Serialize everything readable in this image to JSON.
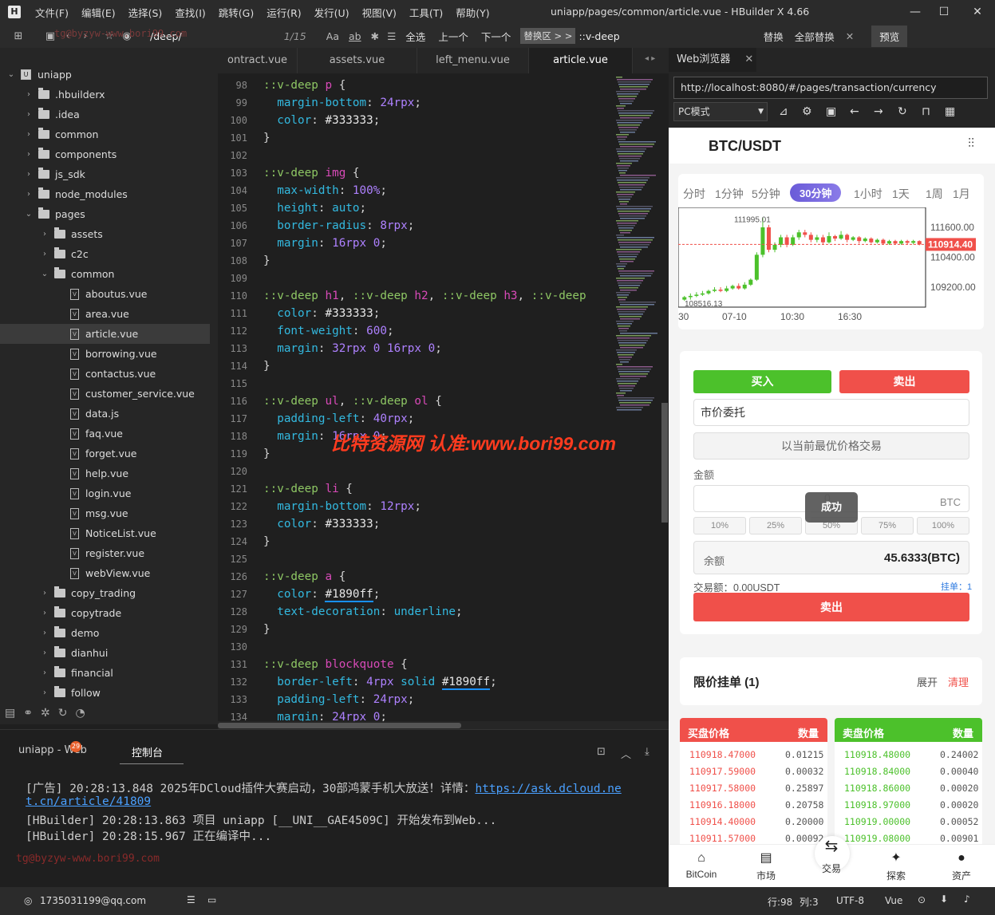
{
  "window": {
    "title": "uniapp/pages/common/article.vue - HBuilder X 4.66",
    "menu": [
      "文件(F)",
      "编辑(E)",
      "选择(S)",
      "查找(I)",
      "跳转(G)",
      "运行(R)",
      "发行(U)",
      "视图(V)",
      "工具(T)",
      "帮助(Y)"
    ],
    "controls": {
      "min": "—",
      "max": "☐",
      "close": "✕"
    }
  },
  "toolbar": {
    "search_value": "/deep/",
    "match_count": "1/15",
    "case_icon": "Aa",
    "word_icon": "ab",
    "select_all": "全选",
    "prev": "上一个",
    "next": "下一个",
    "replace_zone": "替换区 > >",
    "replace_value": "::v-deep",
    "replace": "替换",
    "replace_all": "全部替换",
    "preview": "预览",
    "watermark_small": "tg@byzyw-www.bori99.com"
  },
  "sidebar": {
    "items": [
      {
        "label": "uniapp",
        "type": "root",
        "open": true,
        "level": 0
      },
      {
        "label": ".hbuilderx",
        "type": "folder",
        "open": false,
        "level": 1
      },
      {
        "label": ".idea",
        "type": "folder",
        "open": false,
        "level": 1
      },
      {
        "label": "common",
        "type": "folder",
        "open": false,
        "level": 1
      },
      {
        "label": "components",
        "type": "folder",
        "open": false,
        "level": 1
      },
      {
        "label": "js_sdk",
        "type": "folder",
        "open": false,
        "level": 1
      },
      {
        "label": "node_modules",
        "type": "folder",
        "open": false,
        "level": 1
      },
      {
        "label": "pages",
        "type": "folder",
        "open": true,
        "level": 1
      },
      {
        "label": "assets",
        "type": "folder",
        "open": false,
        "level": 2
      },
      {
        "label": "c2c",
        "type": "folder",
        "open": false,
        "level": 2
      },
      {
        "label": "common",
        "type": "folder",
        "open": true,
        "level": 2
      },
      {
        "label": "aboutus.vue",
        "type": "file",
        "level": 3
      },
      {
        "label": "area.vue",
        "type": "file",
        "level": 3
      },
      {
        "label": "article.vue",
        "type": "file",
        "level": 3,
        "selected": true
      },
      {
        "label": "borrowing.vue",
        "type": "file",
        "level": 3
      },
      {
        "label": "contactus.vue",
        "type": "file",
        "level": 3
      },
      {
        "label": "customer_service.vue",
        "type": "file",
        "level": 3
      },
      {
        "label": "data.js",
        "type": "file",
        "level": 3
      },
      {
        "label": "faq.vue",
        "type": "file",
        "level": 3
      },
      {
        "label": "forget.vue",
        "type": "file",
        "level": 3
      },
      {
        "label": "help.vue",
        "type": "file",
        "level": 3
      },
      {
        "label": "login.vue",
        "type": "file",
        "level": 3
      },
      {
        "label": "msg.vue",
        "type": "file",
        "level": 3
      },
      {
        "label": "NoticeList.vue",
        "type": "file",
        "level": 3
      },
      {
        "label": "register.vue",
        "type": "file",
        "level": 3
      },
      {
        "label": "webView.vue",
        "type": "file",
        "level": 3
      },
      {
        "label": "copy_trading",
        "type": "folder",
        "open": false,
        "level": 2
      },
      {
        "label": "copytrade",
        "type": "folder",
        "open": false,
        "level": 2
      },
      {
        "label": "demo",
        "type": "folder",
        "open": false,
        "level": 2
      },
      {
        "label": "dianhui",
        "type": "folder",
        "open": false,
        "level": 2
      },
      {
        "label": "financial",
        "type": "folder",
        "open": false,
        "level": 2
      },
      {
        "label": "follow",
        "type": "folder",
        "open": false,
        "level": 2
      }
    ]
  },
  "editor": {
    "tabs": [
      "ontract.vue",
      "assets.vue",
      "left_menu.vue",
      "article.vue"
    ],
    "active_tab": "article.vue",
    "lines": [
      {
        "n": "98",
        "html": "<span class='k'>::v-deep</span> <span class='t'>p</span> {"
      },
      {
        "n": "99",
        "html": "  <span class='p'>margin-bottom</span>: <span class='n'>24rpx</span>;"
      },
      {
        "n": "100",
        "html": "  <span class='p'>color</span>: <span class='h'>#333333</span>;"
      },
      {
        "n": "101",
        "html": "}"
      },
      {
        "n": "102",
        "html": ""
      },
      {
        "n": "103",
        "html": "<span class='k'>::v-deep</span> <span class='t'>img</span> {"
      },
      {
        "n": "104",
        "html": "  <span class='p'>max-width</span>: <span class='n'>100%</span>;"
      },
      {
        "n": "105",
        "html": "  <span class='p'>height</span>: <span class='p'>auto</span>;"
      },
      {
        "n": "106",
        "html": "  <span class='p'>border-radius</span>: <span class='n'>8rpx</span>;"
      },
      {
        "n": "107",
        "html": "  <span class='p'>margin</span>: <span class='n'>16rpx</span> <span class='n'>0</span>;"
      },
      {
        "n": "108",
        "html": "}"
      },
      {
        "n": "109",
        "html": ""
      },
      {
        "n": "110",
        "html": "<span class='k'>::v-deep</span> <span class='t'>h1</span>, <span class='k'>::v-deep</span> <span class='t'>h2</span>, <span class='k'>::v-deep</span> <span class='t'>h3</span>, <span class='k'>::v-deep</span>"
      },
      {
        "n": "111",
        "html": "  <span class='p'>color</span>: <span class='h'>#333333</span>;"
      },
      {
        "n": "112",
        "html": "  <span class='p'>font-weight</span>: <span class='n'>600</span>;"
      },
      {
        "n": "113",
        "html": "  <span class='p'>margin</span>: <span class='n'>32rpx</span> <span class='n'>0</span> <span class='n'>16rpx</span> <span class='n'>0</span>;"
      },
      {
        "n": "114",
        "html": "}"
      },
      {
        "n": "115",
        "html": ""
      },
      {
        "n": "116",
        "html": "<span class='k'>::v-deep</span> <span class='t'>ul</span>, <span class='k'>::v-deep</span> <span class='t'>ol</span> {"
      },
      {
        "n": "117",
        "html": "  <span class='p'>padding-left</span>: <span class='n'>40rpx</span>;"
      },
      {
        "n": "118",
        "html": "  <span class='p'>margin</span>: <span class='n'>16rpx</span> <span class='n'>0</span>;"
      },
      {
        "n": "119",
        "html": "}"
      },
      {
        "n": "120",
        "html": ""
      },
      {
        "n": "121",
        "html": "<span class='k'>::v-deep</span> <span class='t'>li</span> {"
      },
      {
        "n": "122",
        "html": "  <span class='p'>margin-bottom</span>: <span class='n'>12rpx</span>;"
      },
      {
        "n": "123",
        "html": "  <span class='p'>color</span>: <span class='h'>#333333</span>;"
      },
      {
        "n": "124",
        "html": "}"
      },
      {
        "n": "125",
        "html": ""
      },
      {
        "n": "126",
        "html": "<span class='k'>::v-deep</span> <span class='t'>a</span> {"
      },
      {
        "n": "127",
        "html": "  <span class='p'>color</span>: <span class='h' style='border-bottom:2px solid #1890ff'>#1890ff</span>;"
      },
      {
        "n": "128",
        "html": "  <span class='p'>text-decoration</span>: <span class='p'>underline</span>;"
      },
      {
        "n": "129",
        "html": "}"
      },
      {
        "n": "130",
        "html": ""
      },
      {
        "n": "131",
        "html": "<span class='k'>::v-deep</span> <span class='t'>blockquote</span> {"
      },
      {
        "n": "132",
        "html": "  <span class='p'>border-left</span>: <span class='n'>4rpx</span> <span class='p'>solid</span> <span class='h' style='border-bottom:2px solid #1890ff'>#1890ff</span>;"
      },
      {
        "n": "133",
        "html": "  <span class='p'>padding-left</span>: <span class='n'>24rpx</span>;"
      },
      {
        "n": "134",
        "html": "  <span class='p'>margin</span>: <span class='n'>24rpx</span> <span class='n'>0</span>;"
      }
    ],
    "watermark": "比特资源网 认准:www.bori99.com"
  },
  "console": {
    "tabs": [
      "uniapp - Web",
      "控制台"
    ],
    "badge": "29",
    "lines": [
      {
        "text": "[广告] 20:28:13.848 2025年DCloud插件大赛启动，30部鸿蒙手机大放送！详情：",
        "link": "https://ask.dcloud.ne"
      },
      {
        "text": "",
        "link": "t.cn/article/41809"
      },
      {
        "text": "[HBuilder] 20:28:13.863 项目 uniapp [__UNI__GAE4509C] 开始发布到Web...",
        "link": ""
      },
      {
        "text": "[HBuilder] 20:28:15.967 正在编译中...",
        "link": ""
      }
    ],
    "watermark": "tg@byzyw-www.bori99.com"
  },
  "status": {
    "user": "1735031199@qq.com",
    "line": "行:98",
    "col": "列:3",
    "encoding": "UTF-8",
    "lang": "Vue"
  },
  "browser": {
    "tab": "Web浏览器",
    "url": "http://localhost:8080/#/pages/transaction/currency",
    "mode": "PC模式",
    "page": {
      "pair": "BTC/USDT",
      "periods": [
        "分时",
        "1分钟",
        "5分钟",
        "30分钟",
        "1小时",
        "1天",
        "1周",
        "1月"
      ],
      "active_period": "30分钟",
      "price_axis": [
        "111600.00",
        "110400.00",
        "109200.00"
      ],
      "current_price": "110914.40",
      "high_label": "111995.01",
      "low_label": "108516.13",
      "time_axis": [
        "30",
        "07-10",
        "10:30",
        "16:30"
      ],
      "buy": "买入",
      "sell": "卖出",
      "order_type": "市价委托",
      "best_price": "以当前最优价格交易",
      "amount_label": "金额",
      "amount_value": "0",
      "amount_unit": "BTC",
      "toast": "成功",
      "percents": [
        "10%",
        "25%",
        "50%",
        "75%",
        "100%"
      ],
      "balance_label": "余额",
      "balance_value": "45.6333(BTC)",
      "trade_amount": "交易额：0.00USDT",
      "pending": "挂单：1",
      "submit": "卖出",
      "limit_title": "限价挂单 (1)",
      "expand": "展开",
      "clear": "清理",
      "buy_header": [
        "买盘价格",
        "数量"
      ],
      "sell_header": [
        "卖盘价格",
        "数量"
      ],
      "buy_orders": [
        [
          "110918.47000",
          "0.01215"
        ],
        [
          "110917.59000",
          "0.00032"
        ],
        [
          "110917.58000",
          "0.25897"
        ],
        [
          "110916.18000",
          "0.20758"
        ],
        [
          "110914.40000",
          "0.20000"
        ],
        [
          "110911.57000",
          "0.00092"
        ]
      ],
      "sell_orders": [
        [
          "110918.48000",
          "0.24002"
        ],
        [
          "110918.84000",
          "0.00040"
        ],
        [
          "110918.86000",
          "0.00020"
        ],
        [
          "110918.97000",
          "0.00020"
        ],
        [
          "110919.00000",
          "0.00052"
        ],
        [
          "110919.08000",
          "0.00901"
        ]
      ],
      "nav": [
        "BitCoin",
        "市场",
        "交易",
        "探索",
        "资产"
      ]
    }
  },
  "chart_data": {
    "type": "candlestick",
    "ylim": [
      108400,
      112400
    ],
    "x_ticks": [
      "30",
      "07-10",
      "10:30",
      "16:30"
    ],
    "candles": [
      [
        108700,
        108800,
        108650,
        108850
      ],
      [
        108800,
        108850,
        108700,
        108950
      ],
      [
        108850,
        108900,
        108800,
        109000
      ],
      [
        108900,
        108950,
        108850,
        109050
      ],
      [
        108950,
        109050,
        108900,
        109100
      ],
      [
        109050,
        109100,
        109000,
        109200
      ],
      [
        109100,
        109050,
        109000,
        109200
      ],
      [
        109050,
        109150,
        109000,
        109250
      ],
      [
        109150,
        109250,
        109100,
        109300
      ],
      [
        109250,
        109150,
        109100,
        109350
      ],
      [
        109150,
        109300,
        109100,
        109400
      ],
      [
        109300,
        109500,
        109250,
        109550
      ],
      [
        109500,
        110500,
        109450,
        110600
      ],
      [
        110500,
        111600,
        110400,
        111995
      ],
      [
        111600,
        110700,
        110600,
        111700
      ],
      [
        110700,
        110900,
        110600,
        111000
      ],
      [
        110900,
        111200,
        110800,
        111300
      ],
      [
        111200,
        110900,
        110800,
        111300
      ],
      [
        110900,
        111200,
        110850,
        111300
      ],
      [
        111200,
        111400,
        111100,
        111500
      ],
      [
        111400,
        111300,
        111200,
        111500
      ],
      [
        111300,
        111100,
        111000,
        111400
      ],
      [
        111100,
        111200,
        111000,
        111300
      ],
      [
        111200,
        111000,
        110900,
        111300
      ],
      [
        111000,
        111250,
        110950,
        111400
      ],
      [
        111250,
        111150,
        111050,
        111300
      ],
      [
        111150,
        111300,
        111100,
        111450
      ],
      [
        111300,
        111100,
        111000,
        111350
      ],
      [
        111100,
        111200,
        111050,
        111250
      ],
      [
        111200,
        111050,
        110950,
        111250
      ],
      [
        111050,
        111150,
        111000,
        111200
      ],
      [
        111150,
        111000,
        110950,
        111200
      ],
      [
        111000,
        111100,
        110950,
        111150
      ],
      [
        111100,
        110950,
        110900,
        111150
      ],
      [
        110950,
        111050,
        110900,
        111100
      ],
      [
        111050,
        110950,
        110900,
        111100
      ],
      [
        110950,
        111050,
        110900,
        111100
      ],
      [
        111050,
        110980,
        110900,
        111100
      ],
      [
        110980,
        111050,
        110920,
        111100
      ],
      [
        111050,
        110914,
        110880,
        111080
      ]
    ],
    "current": 110914.4
  }
}
